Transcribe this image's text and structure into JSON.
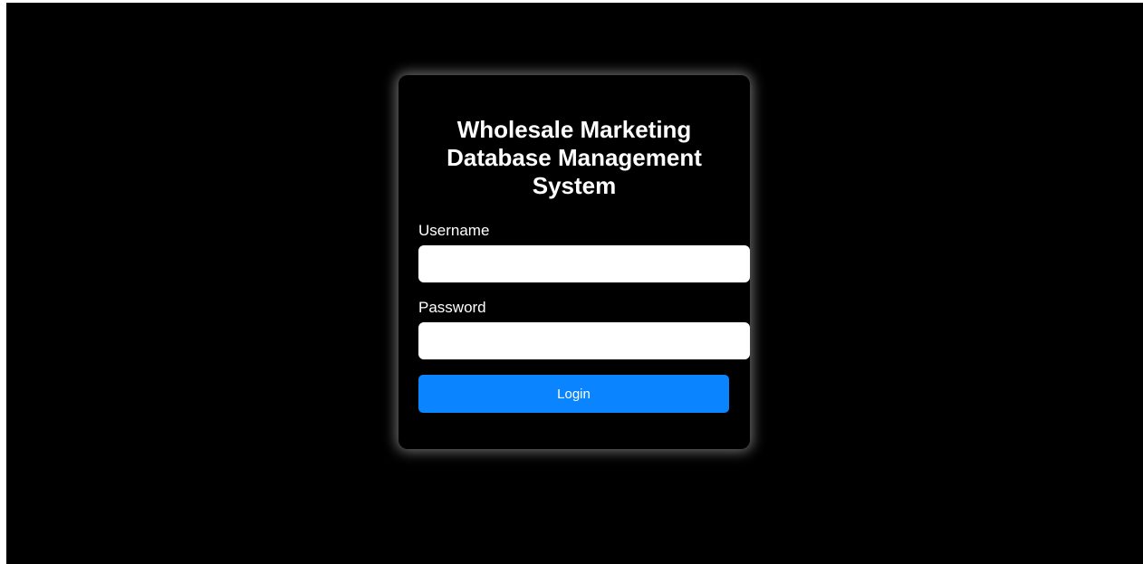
{
  "login": {
    "title": "Wholesale Marketing Database Management System",
    "username_label": "Username",
    "username_value": "",
    "password_label": "Password",
    "password_value": "",
    "submit_label": "Login"
  },
  "colors": {
    "background": "#000000",
    "card": "#000000",
    "input": "#ffffff",
    "button": "#0a84ff",
    "text": "#ffffff"
  }
}
